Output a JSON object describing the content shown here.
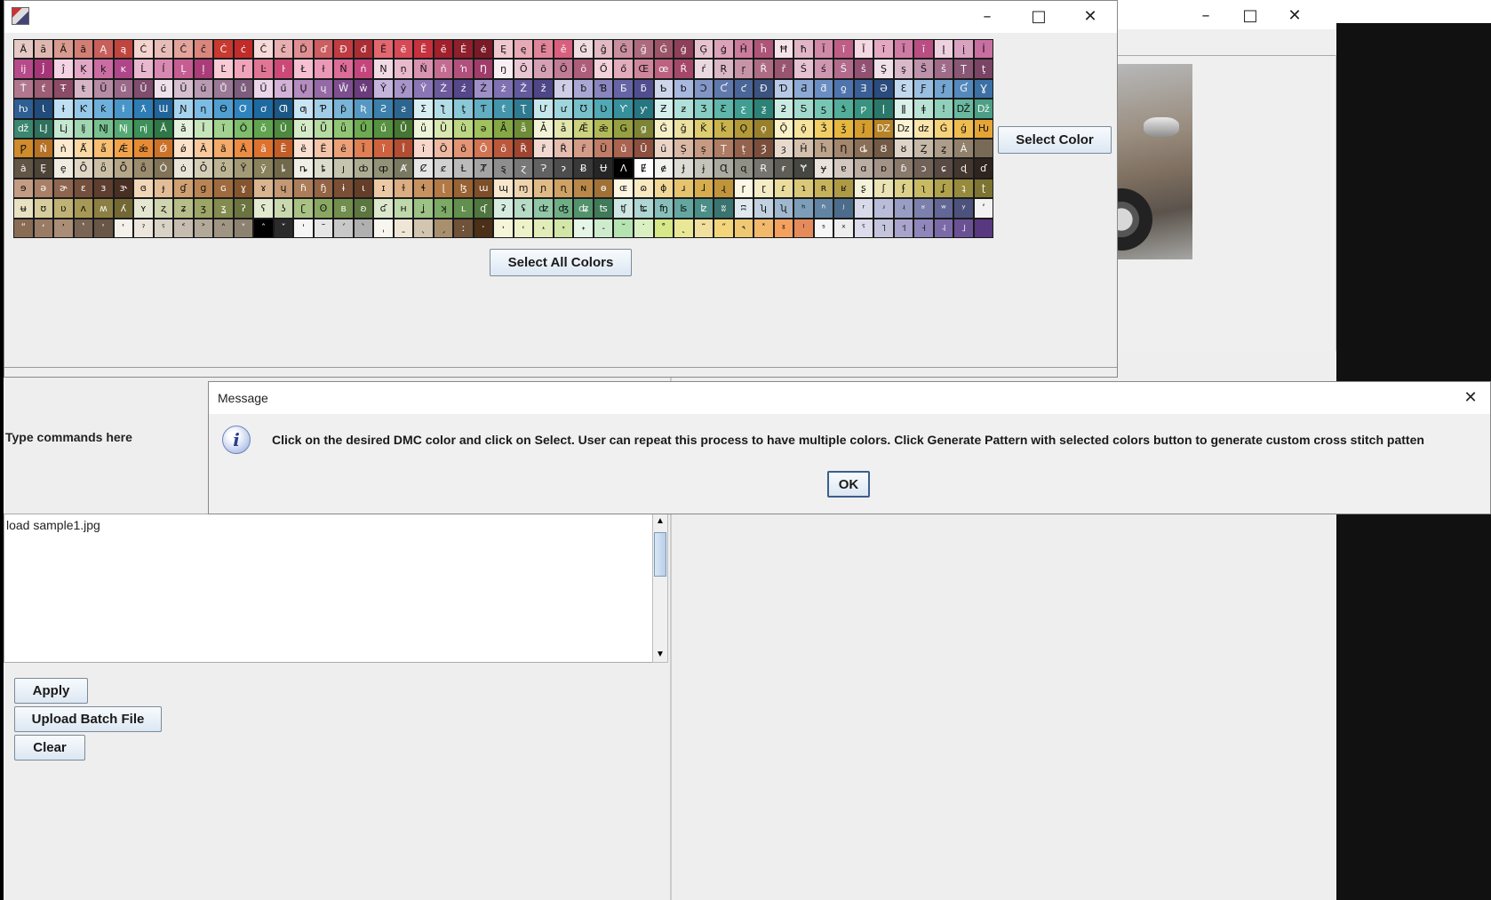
{
  "main_window": {
    "command_label": "Type commands here",
    "command_log": "load sample1.jpg",
    "buttons": {
      "apply": "Apply",
      "upload_batch": "Upload Batch File",
      "clear": "Clear"
    }
  },
  "color_window": {
    "select_color_label": "Select Color",
    "select_all_label": "Select All Colors",
    "palette_rows": [
      "Ȃ ȃ Ă ă Ą ą Ć ć Ĉ ĉ Ċ ċ Č č Ď ď Đ đ Ē ē Ĕ ĕ Ė ė Ę ę Ě ě Ĝ ĝ Ğ ğ Ġ ġ Ģ ģ Ĥ ĥ Ħ ħ Ĩ ĩ Ī ī Ĭ ĭ Į į İ ı Ĳ",
      "ĳ Ĵ ĵ Ķ ķ ĸ Ĺ ĺ Ļ ļ Ľ ľ Ŀ ŀ Ł ł Ń ń Ņ ņ Ň ň ŉ Ŋ ŋ Ō ō Ŏ ŏ Ő ő Œ œ Ŕ ŕ Ŗ ŗ Ř ř Ś ś Ŝ ŝ Ş ş Š š Ţ ţ",
      "Ť ť Ŧ ŧ Ũ ũ Ū ū Ŭ ŭ Ů ů Ű ű Ų ų Ŵ ŵ Ŷ ŷ Ÿ Ź ź Ż ż Ž ž ſ ƀ Ɓ Ƃ ƃ Ƅ ƅ Ɔ Ƈ ƈ Ɖ Ɗ Ƌ ƌ ƍ Ǝ Ə Ɛ Ƒ ƒ Ɠ Ɣ",
      "ƕ Ɩ Ɨ Ƙ ƙ ƚ ƛ Ɯ Ɲ ƞ Ɵ Ơ ơ Ƣ ƣ Ƥ ƥ Ʀ Ƨ ƨ Ʃ ƪ ƫ Ƭ ƭ Ʈ Ư ư Ʊ Ʋ Ƴ ƴ Ƶ ƶ Ʒ Ƹ ƹ ƺ ƻ Ƽ ƽ ƾ ƿ ǀ ǁ ǂ ǃ Ǆ ǅ",
      "ǆ Ǉ ǈ ǉ Ǌ ǋ ǌ Ǎ ǎ Ǐ ǐ Ǒ ǒ Ǔ ǔ Ǖ ǖ Ǘ ǘ Ǚ ǚ Ǜ ǜ ǝ Ǟ ǟ Ǡ ǡ Ǣ ǣ Ǥ ǥ Ǧ ǧ Ǩ ǩ Ǫ ǫ Ǭ ǭ Ǯ ǯ ǰ Ǳ ǲ ǳ Ǵ ǵ Ƕ",
      "Ƿ Ǹ ǹ Ǻ ǻ Ǽ ǽ Ǿ ǿ Ȁ ȁ Ȃ ȃ Ȅ ȅ Ȇ ȇ Ȉ ȉ Ȋ ȋ Ȍ ȍ Ȏ ȏ Ȑ ȑ Ȓ ȓ Ȕ ȕ Ȗ ȗ Ș ș Ț ț Ȝ ȝ Ȟ ȟ Ƞ ȡ Ȣ ȣ Ȥ ȥ Ȧ",
      "ȧ Ȩ ȩ Ȫ ȫ Ȭ ȭ Ȯ ȯ Ȱ ȱ Ȳ ȳ ȴ ȵ ȶ ȷ ȸ ȹ Ⱥ Ȼ ȼ Ƚ Ⱦ ȿ ɀ Ɂ ɂ Ƀ Ʉ Ʌ Ɇ ɇ Ɉ ɉ Ɋ ɋ Ɍ ɍ Ɏ ɏ ɐ ɑ ɒ ɓ ɔ ɕ ɖ ɗ",
      "ɘ ə ɚ ɛ ɜ ɝ ɞ ɟ ɠ ɡ ɢ ɣ ɤ ɥ ɦ ɧ ɨ ɩ ɪ ɫ ɬ ɭ ɮ ɯ ɰ ɱ ɲ ɳ ɴ ɵ ɶ ɷ ɸ ɹ ɺ ɻ ɼ ɽ ɾ ɿ ʀ ʁ ʂ ʃ ʄ ʅ ʆ ʇ ʈ",
      "ʉ ʊ ʋ ʌ ʍ ʎ ʏ ʐ ʑ ʒ ʓ ʔ ʕ ʖ ʗ ʘ ʙ ʚ ʛ ʜ ʝ ʞ ʟ ʠ ʡ ʢ ʣ ʤ ʥ ʦ ʧ ʨ ʩ ʪ ʫ ʬ ʭ ʮ ʯ ʰ ʱ ʲ ʳ ʴ ʵ ʶ ʷ ʸ ʹ",
      "ʺ ʻ ʼ ʽ ʾ ʿ ˀ ˁ ˂ ˃ ˄ ˅ ˆ ˇ ˈ ˉ ˊ ˋ ˌ ˍ ˎ ˏ ː ˑ ˒ ˓ ˔ ˕ ˖ ˗ ˘ ˙ ˚ ˛ ˜ ˝ ˞ ˟ ˠ ˡ ˢ ˣ ˤ ˥ ˦ ˧ ˨ ˩"
    ],
    "palette_colors": [
      [
        "#e6c9c4",
        "#dfb7b0",
        "#d99a8f",
        "#d27e74",
        "#c95f5a",
        "#c0453f",
        "#f3d4cf",
        "#e8bdb7",
        "#e3a49c",
        "#da867d",
        "#c8392f",
        "#c12c2b",
        "#f7dada",
        "#e9aeb0",
        "#df8f92",
        "#cc5d60",
        "#c03c42",
        "#aa2d34",
        "#e4676f",
        "#d64a55",
        "#c6313d",
        "#a1202c",
        "#8e1f2b",
        "#7a1a26",
        "#f0c7cf",
        "#e8a9b6",
        "#e08499",
        "#d95f7e",
        "#f0dde1",
        "#e3b9c3",
        "#c98f9e",
        "#ad6a7d",
        "#9b5468",
        "#8e3f59",
        "#e7c3d0",
        "#dba2b8",
        "#cb7b9c",
        "#ae5479",
        "#f6e3ea",
        "#e1b5c6",
        "#d08aa8",
        "#be5e87",
        "#f5d8e3",
        "#e4a8c2",
        "#d07ba4",
        "#b94e82",
        "#eed1e0",
        "#d9a2c1",
        "#c76fa0"
      ],
      [
        "#b74a8a",
        "#a63577",
        "#f4d3e4",
        "#e2a7c6",
        "#cb6ca3",
        "#b0468a",
        "#e8b8cf",
        "#d988b2",
        "#c55d93",
        "#ac3c79",
        "#f7cad6",
        "#f1a4b9",
        "#e17595",
        "#cc4877",
        "#f5c1d2",
        "#ea98b5",
        "#dc6c98",
        "#c6447c",
        "#f2dae4",
        "#e8b9cb",
        "#d993b1",
        "#c46b92",
        "#b2507c",
        "#9f3c6a",
        "#f9eef2",
        "#e9c5d2",
        "#d6a0b4",
        "#c27b96",
        "#ad5c7a",
        "#f3d2dc",
        "#e2acbc",
        "#cf869b",
        "#bc6180",
        "#a54768",
        "#ecd9e0",
        "#dbb6c4",
        "#c793a7",
        "#ae6c84",
        "#995470",
        "#e6c1d2",
        "#cf96b1",
        "#b36b8d",
        "#925073",
        "#f0e0e8",
        "#d9b9c9",
        "#bf92ab",
        "#9f6b89",
        "#8a5675",
        "#7a4464"
      ],
      [
        "#b1778e",
        "#9c5d75",
        "#8c4b66",
        "#d6b5c6",
        "#b78ca5",
        "#9a6888",
        "#7f4d6e",
        "#efe1ea",
        "#d7bfd0",
        "#b99ab3",
        "#9a7996",
        "#7d5d7c",
        "#ebd5ea",
        "#d4b2d8",
        "#b58cbf",
        "#9569a5",
        "#7e4f8f",
        "#6b3c7c",
        "#c5b5dc",
        "#a794c9",
        "#8a76b5",
        "#6c5a9c",
        "#56468a",
        "#9e8fc8",
        "#7f71b2",
        "#625a9d",
        "#4d4687",
        "#d0cde6",
        "#aaa7d4",
        "#8986bf",
        "#6764a6",
        "#514e90",
        "#cfd6ec",
        "#a9b8de",
        "#8296c6",
        "#6079ac",
        "#4a6597",
        "#3c5380",
        "#b7c9e6",
        "#8daad6",
        "#6a8ec4",
        "#4f74ad",
        "#3a5e96",
        "#2a4b7e",
        "#c2d8ee",
        "#9bbfe2",
        "#74a5d1",
        "#5489bd",
        "#3c70a5"
      ],
      [
        "#2d5f94",
        "#204b7a",
        "#bfe0f3",
        "#96c9e9",
        "#6eb0dc",
        "#4896c9",
        "#2d7cb4",
        "#1f649a",
        "#a6d4ef",
        "#7cbbe3",
        "#4f9fd1",
        "#2d83bd",
        "#1d6aa0",
        "#1a5785",
        "#c9e4f2",
        "#a2cde6",
        "#7ab4d7",
        "#5599c2",
        "#3b7fab",
        "#2c6690",
        "#d7eef3",
        "#b2dde7",
        "#8ac8d7",
        "#62afc3",
        "#4295ab",
        "#2e7b91",
        "#c5e7ec",
        "#9fd6de",
        "#77c1cb",
        "#50a9b4",
        "#35909b",
        "#257680",
        "#d6f0ed",
        "#b0e0da",
        "#87cdc4",
        "#5fb6ab",
        "#409d91",
        "#2c8276",
        "#c9ebe2",
        "#a2dbcd",
        "#77c6b4",
        "#52ae99",
        "#379380",
        "#2a7869",
        "#d9f1e8",
        "#b8e3d4",
        "#90d0bb",
        "#69b99f",
        "#4c9f85"
      ],
      [
        "#3b8770",
        "#2f715d",
        "#c7e8d0",
        "#a0d6b2",
        "#77c191",
        "#54aa72",
        "#3c9159",
        "#2e7746",
        "#e4f2dd",
        "#c6e5ba",
        "#a1d290",
        "#7ebd6b",
        "#61a44f",
        "#4d8a3f",
        "#d5ebc7",
        "#b5dba0",
        "#90c575",
        "#6dab52",
        "#56913f",
        "#457632",
        "#edf4d7",
        "#d8e8b0",
        "#bcd783",
        "#9fc15e",
        "#86a844",
        "#6d8c35",
        "#f2f3d4",
        "#e3e6ad",
        "#ccd27d",
        "#b1b957",
        "#97a040",
        "#7d8433",
        "#f5f0c6",
        "#ebe1a0",
        "#ddcc70",
        "#c9b34c",
        "#b39a38",
        "#98802b",
        "#fbf1c7",
        "#f7e39c",
        "#f1cf66",
        "#e6b73f",
        "#d49d2d",
        "#b78326",
        "#fdf3d5",
        "#fae5ab",
        "#f6d27a",
        "#efbc4f",
        "#e4a535"
      ],
      [
        "#d08b2b",
        "#b57124",
        "#fde9cd",
        "#fbd7a3",
        "#f8bf72",
        "#f2a34a",
        "#e68b33",
        "#cc7228",
        "#fde2c8",
        "#f9c99b",
        "#f4aa69",
        "#ec8c43",
        "#dd722f",
        "#c25d26",
        "#fbe0d0",
        "#f5c3a7",
        "#eda078",
        "#e07e54",
        "#ce623e",
        "#b34d31",
        "#f7d7c9",
        "#efb9a1",
        "#e39474",
        "#d27352",
        "#bb583c",
        "#9f452f",
        "#f2d9cf",
        "#e5bcad",
        "#d49b86",
        "#c07c66",
        "#a9634f",
        "#8e4f3e",
        "#ebd4c6",
        "#dbb8a4",
        "#c69982",
        "#ae7b63",
        "#94624c",
        "#7b4e3c",
        "#e7d9cc",
        "#d4c0ac",
        "#bda38a",
        "#a3876d",
        "#8a6f56",
        "#735a45",
        "#ddd3c6",
        "#c6b8a7",
        "#ac9c88",
        "#91816c",
        "#786a57"
      ],
      [
        "#615545",
        "#4d4437",
        "#f0ebe0",
        "#e0d6c4",
        "#ccbfa6",
        "#b5a687",
        "#9b8c6d",
        "#817357",
        "#e8e4d6",
        "#d4cdb6",
        "#bdb493",
        "#a39a75",
        "#8a815d",
        "#71694a",
        "#efefe5",
        "#dcdccc",
        "#c5c5af",
        "#acac92",
        "#929277",
        "#797961",
        "#e6e6e6",
        "#d1d1d1",
        "#bbbbbb",
        "#a4a4a4",
        "#8e8e8e",
        "#787878",
        "#626262",
        "#4d4d4d",
        "#393939",
        "#262626",
        "#000000",
        "#ffffff",
        "#f2f2ee",
        "#dcdcd4",
        "#c4c4ba",
        "#aaaaa0",
        "#909087",
        "#76766e",
        "#5e5e57",
        "#474742",
        "#e8e1dc",
        "#d3c8bf",
        "#bbada2",
        "#a39286",
        "#8a796d",
        "#716157",
        "#594b43",
        "#43372f",
        "#2f251f"
      ],
      [
        "#c49c84",
        "#a97f67",
        "#8e654f",
        "#744f3c",
        "#5e3e2e",
        "#492f22",
        "#f1d6b8",
        "#e2bd96",
        "#cfa072",
        "#b98453",
        "#9f6b3e",
        "#855530",
        "#d9b48f",
        "#c49873",
        "#ad7d59",
        "#946445",
        "#7b4f35",
        "#643e29",
        "#ecc9a4",
        "#dcad80",
        "#c89260",
        "#b27945",
        "#986233",
        "#7e4e28",
        "#f8e7cd",
        "#eed3ad",
        "#e0bb87",
        "#cfa164",
        "#b98848",
        "#a07036",
        "#fdf5e0",
        "#f8e9c1",
        "#f1d897",
        "#e6c36e",
        "#d6ac4e",
        "#c0943a",
        "#fbf7e4",
        "#f4ecc5",
        "#e9dc9d",
        "#dac878",
        "#c6b25a",
        "#ae9a45",
        "#f6f2d9",
        "#ebe3b4",
        "#dcd08a",
        "#c8b965",
        "#b0a24d",
        "#968a3d",
        "#7d7332"
      ],
      [
        "#e9e2c2",
        "#d6cc9c",
        "#bfb274",
        "#a69855",
        "#8c7f42",
        "#736834",
        "#e5e7d0",
        "#d0d4ae",
        "#b7bd88",
        "#9ca466",
        "#838b4e",
        "#6b733f",
        "#e2ead0",
        "#c9d8ad",
        "#aac185",
        "#8aa762",
        "#718e4c",
        "#5b763f",
        "#dbe8cc",
        "#bfd8aa",
        "#9dc285",
        "#7ca964",
        "#628f4d",
        "#4e763e",
        "#d6ece0",
        "#b6dcc6",
        "#91c6a6",
        "#6ead86",
        "#52936d",
        "#3f7a59",
        "#cfe7e4",
        "#aed6d2",
        "#88bfba",
        "#64a7a1",
        "#4a8e88",
        "#397470",
        "#dfe7ef",
        "#c1d1e0",
        "#9fb8ce",
        "#7d9eb9",
        "#6284a2",
        "#4c6c8b",
        "#d8dae9",
        "#b9bdd9",
        "#989dc4",
        "#7b80ad",
        "#626795",
        "#4d527d",
        "#f2f2f2"
      ],
      [
        "#8a6c55",
        "#9a7c65",
        "#aa8d77",
        "#7a6453",
        "#6a5646",
        "#f4f0ea",
        "#ece6dd",
        "#d9d2c6",
        "#c6bdb0",
        "#b3a999",
        "#a09583",
        "#8d826f",
        "#000000",
        "#2b2b2b",
        "#f5f5f5",
        "#e6e6e6",
        "#c8c8c8",
        "#b0b0b0",
        "#f9f6ef",
        "#efe6d6",
        "#d2c6b0",
        "#a88f6e",
        "#6f5237",
        "#4b2f17",
        "#f5f5d9",
        "#eef2c8",
        "#e2ecb8",
        "#d2e6a8",
        "#e5f5e6",
        "#cdeccc",
        "#b5e3b2",
        "#daf0c2",
        "#d6e887",
        "#e8e896",
        "#f0e0a0",
        "#f3d67b",
        "#efc873",
        "#f2b96c",
        "#f4a160",
        "#e58b5a",
        "#f6f6f6",
        "#eeeeee",
        "#dcdcec",
        "#c4c4dc",
        "#a9a4cc",
        "#8f86bc",
        "#7b6aa8",
        "#6a5194",
        "#58387e"
      ]
    ]
  },
  "back_window": {},
  "message_dialog": {
    "title": "Message",
    "text": "Click on the desired DMC color and click on Select. User can repeat this process to have multiple colors. Click Generate Pattern with selected colors button to generate custom cross stitch patten",
    "ok_label": "OK"
  }
}
